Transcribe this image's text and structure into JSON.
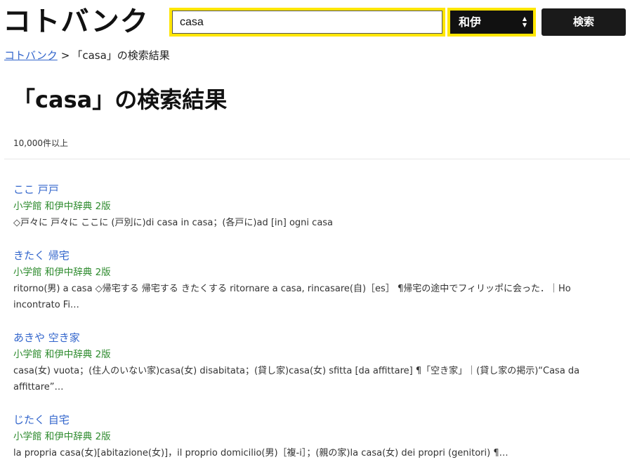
{
  "header": {
    "logo": "コトバンク",
    "search_value": "casa",
    "dictionary_select": "和伊",
    "search_button": "検索"
  },
  "breadcrumb": {
    "home": "コトバンク",
    "separator": ">",
    "current": "「casa」の検索結果"
  },
  "page": {
    "title": "「casa」の検索結果",
    "count": "10,000件以上"
  },
  "results": [
    {
      "title": "ここ 戸戸",
      "source": "小学館 和伊中辞典 2版",
      "snippet": "◇戸々に 戸々に ここに (戸別に)di casa in casa；(各戸に)ad [in] ogni casa"
    },
    {
      "title": "きたく 帰宅",
      "source": "小学館 和伊中辞典 2版",
      "snippet": "ritorno(男) a casa ◇帰宅する 帰宅する きたくする ritornare a casa, rincasare(自)［es］ ¶帰宅の途中でフィリッポに会った．｜Ho incontrato Fi…"
    },
    {
      "title": "あきや 空き家",
      "source": "小学館 和伊中辞典 2版",
      "snippet": "casa(女) vuota；(住人のいない家)casa(女) disabitata；(貸し家)casa(女) sfitta [da affittare] ¶「空き家」｜(貸し家の掲示)“Casa da affittare”…"
    },
    {
      "title": "じたく 自宅",
      "source": "小学館 和伊中辞典 2版",
      "snippet": "la propria casa(女)[abitazione(女)]，il proprio domicilio(男)［複-i］；(親の家)la casa(女) dei propri (genitori) ¶…"
    }
  ]
}
